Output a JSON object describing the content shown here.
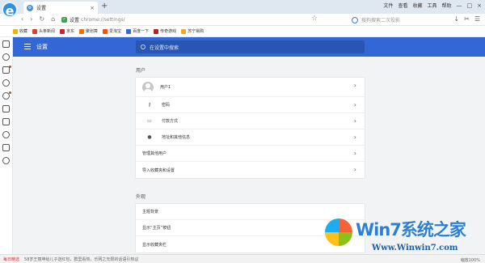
{
  "browser": {
    "tab_title": "设置",
    "tab_close": "×",
    "new_tab": "+",
    "system_menu": [
      "文件",
      "查看",
      "收藏",
      "工具",
      "帮助"
    ],
    "window_buttons": [
      "—",
      "□",
      "×"
    ]
  },
  "navbar": {
    "back": "‹",
    "forward": "›",
    "reload": "↻",
    "home": "⌂",
    "url_host": "设置",
    "url_path": "chrome://settings/",
    "search_placeholder": "搜狗搜索二次投影",
    "right_icons": [
      "↓",
      "✂",
      "☰"
    ]
  },
  "bookmarks": [
    {
      "label": "收藏",
      "color": "#f0b400"
    },
    {
      "label": "头条新闻",
      "color": "#e33b2e"
    },
    {
      "label": "京东",
      "color": "#d4202a"
    },
    {
      "label": "聚划算",
      "color": "#ff6a00"
    },
    {
      "label": "爱淘宝",
      "color": "#ff5000"
    },
    {
      "label": "百度一下",
      "color": "#2f6ae0"
    },
    {
      "label": "传奇游戏",
      "color": "#b3241f"
    },
    {
      "label": "苏宁易购",
      "color": "#f5a623"
    }
  ],
  "settings": {
    "title": "设置",
    "search_placeholder": "在设置中搜索",
    "people": {
      "title": "用户",
      "profile_name": "用户1",
      "rows": [
        {
          "label": "密码",
          "icon": "key-icon"
        },
        {
          "label": "付款方式",
          "icon": "card-icon"
        },
        {
          "label": "地址和其他信息",
          "icon": "location-pin-icon"
        },
        {
          "label": "管理其他用户"
        },
        {
          "label": "导入收藏夹和设置"
        }
      ]
    },
    "appearance": {
      "title": "外观",
      "rows": [
        {
          "label": "主题背景"
        },
        {
          "label": "显示“主页”按钮"
        },
        {
          "label": "显示收藏夹栏"
        }
      ]
    }
  },
  "statusbar": {
    "warning": "每日精选",
    "news": "58岁王丽坤给儿子送红包，群里看热，乐网之无限的话语引热议",
    "zoom": "缩放100%"
  },
  "watermark": {
    "brand": "Win7系统之家",
    "url": "Www.Winwin7.com"
  },
  "colors": {
    "header_blue": "#3367d6",
    "page_bg": "#f1f3f4"
  }
}
